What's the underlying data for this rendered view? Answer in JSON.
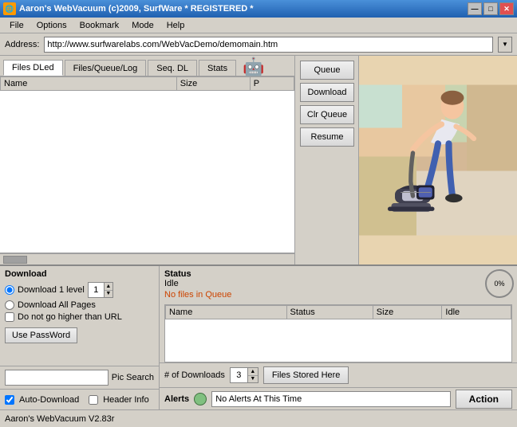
{
  "titlebar": {
    "title": "Aaron's WebVacuum  (c)2009, SurfWare * REGISTERED *",
    "icon": "💻"
  },
  "titlebar_controls": {
    "minimize": "—",
    "maximize": "□",
    "close": "✕"
  },
  "menu": {
    "items": [
      "File",
      "Options",
      "Bookmark",
      "Mode",
      "Help"
    ]
  },
  "address": {
    "label": "Address:",
    "value": "http://www.surfwarelabs.com/WebVacDemo/demomain.htm",
    "placeholder": ""
  },
  "tabs": {
    "items": [
      "Files DLed",
      "Files/Queue/Log",
      "Seq. DL",
      "Stats"
    ],
    "active": 0
  },
  "file_table": {
    "columns": [
      "Name",
      "Size",
      "P"
    ]
  },
  "buttons": {
    "queue": "Queue",
    "download": "Download",
    "clr_queue": "Clr Queue",
    "resume": "Resume"
  },
  "download_panel": {
    "title": "Download",
    "radio1": "Download 1 level",
    "level_value": "1",
    "radio2": "Download All Pages",
    "checkbox_label": "Do not go higher than URL",
    "use_password_btn": "Use PassWord"
  },
  "pic_search": {
    "value": "",
    "label": "Pic Search"
  },
  "auto_download": {
    "checkbox_label": "Auto-Download",
    "header_info_label": "Header Info"
  },
  "status_panel": {
    "title": "Status",
    "idle_text": "Idle",
    "no_files_text": "No files in Queue",
    "columns": [
      "Name",
      "Status",
      "Size",
      "Idle"
    ],
    "progress": "0%"
  },
  "downloads_row": {
    "label": "# of Downloads",
    "value": "3",
    "files_stored_btn": "Files Stored Here"
  },
  "alerts": {
    "label": "Alerts",
    "text": "No Alerts At This Time",
    "action_btn": "Action"
  },
  "status_bar": {
    "text": "Aaron's WebVacuum V2.83r"
  }
}
